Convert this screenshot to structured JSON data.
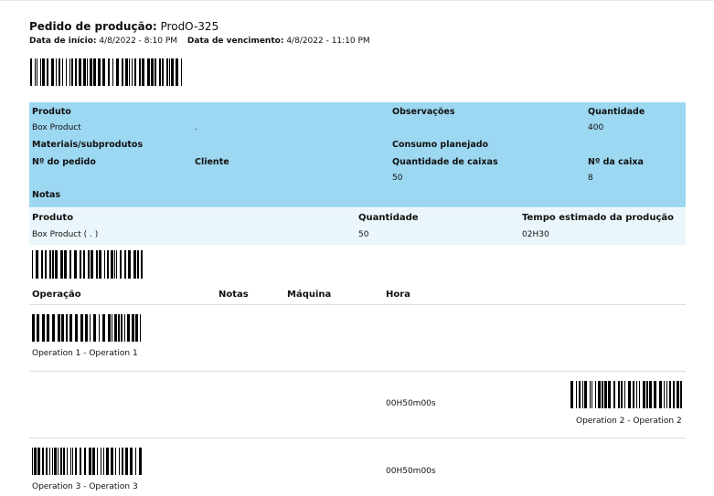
{
  "header": {
    "title_label": "Pedido de produção:",
    "order_ref": "ProdO-325",
    "start_label": "Data de início:",
    "start_value": "4/8/2022 - 8:10 PM",
    "due_label": "Data de vencimento:",
    "due_value": "4/8/2022 - 11:10 PM"
  },
  "info": {
    "product_label": "Produto",
    "product_value": "Box Product",
    "product_extra": ".",
    "notes_col_label": "Observações",
    "qty_label": "Quantidade",
    "qty_value": "400",
    "materials_label": "Materiais/subprodutos",
    "planned_label": "Consumo planejado",
    "order_no_label": "Nº do pedido",
    "client_label": "Cliente",
    "boxes_qty_label": "Quantidade de caixas",
    "boxes_qty_value": "50",
    "box_no_label": "Nº da caixa",
    "box_no_value": "8",
    "notes_label": "Notas"
  },
  "product_table": {
    "product_label": "Produto",
    "qty_label": "Quantidade",
    "time_label": "Tempo estimado da produção",
    "product_value": "Box Product ( . )",
    "qty_value": "50",
    "time_value": "02H30"
  },
  "operations": {
    "headers": {
      "operation": "Operação",
      "notes": "Notas",
      "machine": "Máquina",
      "time": "Hora"
    },
    "rows": [
      {
        "name": "Operation 1 - Operation 1",
        "time": ""
      },
      {
        "name": "Operation 2 - Operation 2",
        "time": "00H50m00s"
      },
      {
        "name": "Operation 3 - Operation 3",
        "time": "00H50m00s"
      }
    ]
  }
}
